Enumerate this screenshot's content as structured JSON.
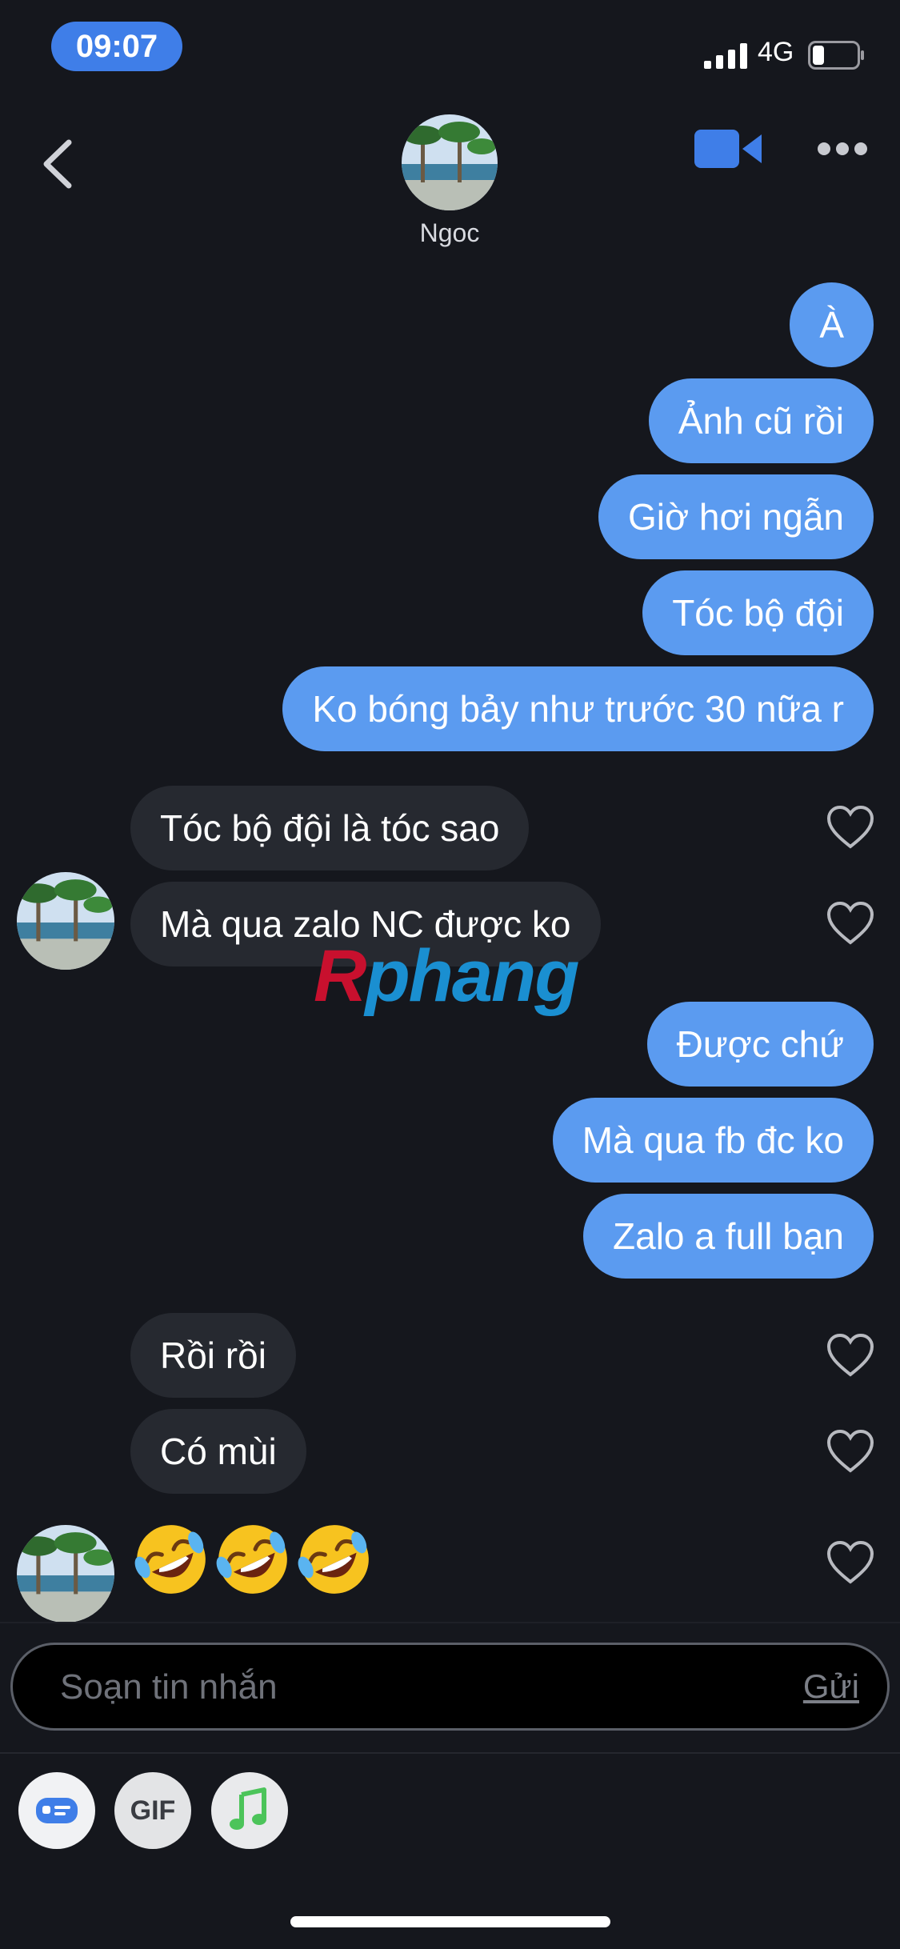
{
  "status_bar": {
    "time": "09:07",
    "network": "4G"
  },
  "header": {
    "contact_name": "Ngoc"
  },
  "messages": [
    {
      "dir": "out",
      "text": "À"
    },
    {
      "dir": "out",
      "text": "Ảnh cũ rồi"
    },
    {
      "dir": "out",
      "text": "Giờ hơi ngẫn"
    },
    {
      "dir": "out",
      "text": "Tóc bộ đội"
    },
    {
      "dir": "out",
      "text": "Ko bóng bảy như trước 30 nữa r"
    },
    {
      "dir": "in",
      "text": "Tóc bộ đội là tóc sao"
    },
    {
      "dir": "in",
      "text": "Mà qua zalo NC được ko"
    },
    {
      "dir": "out",
      "text": "Được chứ"
    },
    {
      "dir": "out",
      "text": "Mà qua fb đc ko"
    },
    {
      "dir": "out",
      "text": "Zalo a full bạn"
    },
    {
      "dir": "in",
      "text": "Rồi rồi"
    },
    {
      "dir": "in",
      "text": "Có mùi"
    },
    {
      "dir": "in",
      "emoji": [
        "rolling-on-floor-laughing",
        "rolling-on-floor-laughing",
        "rolling-on-floor-laughing"
      ]
    }
  ],
  "watermark": {
    "text_a": "R",
    "text_b": "phang"
  },
  "composer": {
    "placeholder": "Soạn tin nhắn",
    "send_label": "Gửi"
  },
  "toolbar": {
    "gif_label": "GIF"
  },
  "colors": {
    "outgoing_bubble": "#5b9bf0",
    "incoming_bubble": "#262930",
    "background": "#15171d",
    "accent": "#3f7ee8"
  },
  "icons": [
    "back-chevron-icon",
    "video-call-icon",
    "more-icon",
    "heart-icon",
    "card-icon",
    "music-note-icon"
  ]
}
